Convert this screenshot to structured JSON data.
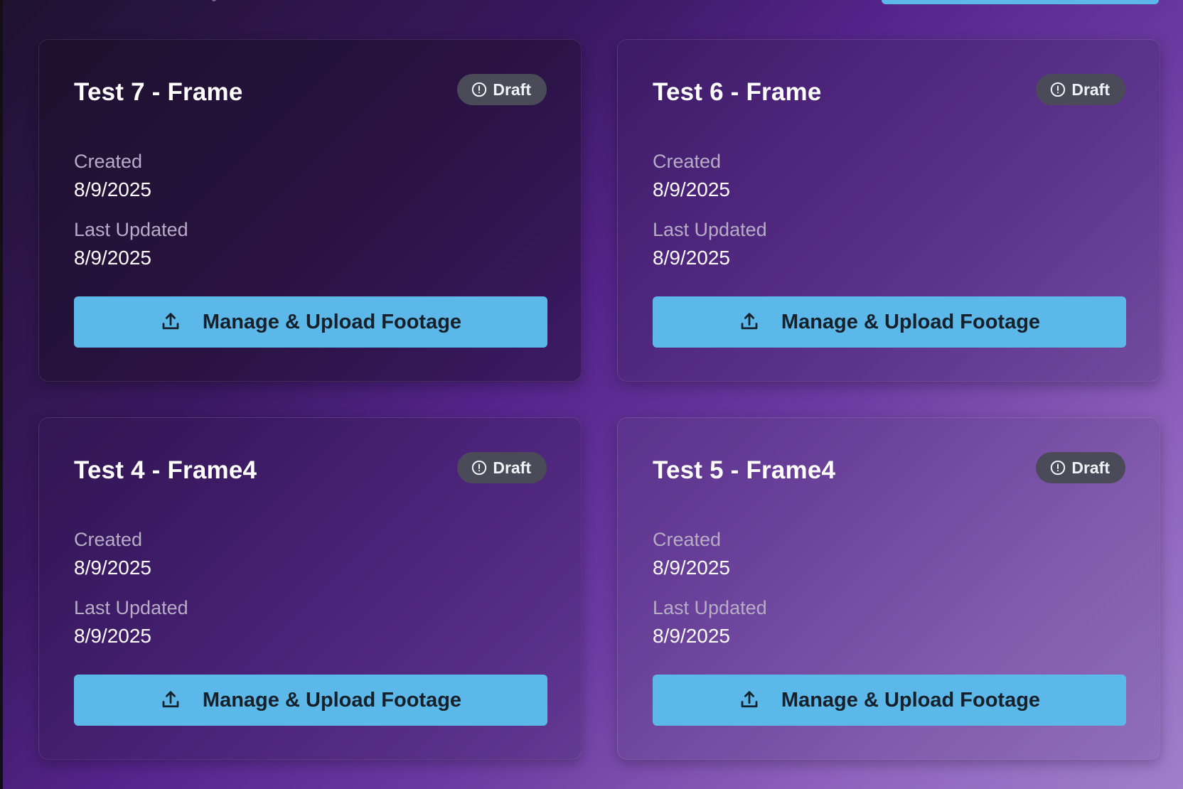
{
  "colors": {
    "accent": "#5bb8e8",
    "badge_bg": "#4a4a58",
    "title_text": "#ffffff",
    "label_text": "#b6adc6"
  },
  "cards": [
    {
      "title": "Test 7 - Frame",
      "status": "Draft",
      "status_icon": "alert-circle-icon",
      "created_label": "Created",
      "created": "8/9/2025",
      "updated_label": "Last Updated",
      "updated": "8/9/2025",
      "action_label": "Manage & Upload Footage",
      "action_icon": "upload-icon"
    },
    {
      "title": "Test 6 - Frame",
      "status": "Draft",
      "status_icon": "alert-circle-icon",
      "created_label": "Created",
      "created": "8/9/2025",
      "updated_label": "Last Updated",
      "updated": "8/9/2025",
      "action_label": "Manage & Upload Footage",
      "action_icon": "upload-icon"
    },
    {
      "title": "Test 4 - Frame4",
      "status": "Draft",
      "status_icon": "alert-circle-icon",
      "created_label": "Created",
      "created": "8/9/2025",
      "updated_label": "Last Updated",
      "updated": "8/9/2025",
      "action_label": "Manage & Upload Footage",
      "action_icon": "upload-icon"
    },
    {
      "title": "Test 5 - Frame4",
      "status": "Draft",
      "status_icon": "alert-circle-icon",
      "created_label": "Created",
      "created": "8/9/2025",
      "updated_label": "Last Updated",
      "updated": "8/9/2025",
      "action_label": "Manage & Upload Footage",
      "action_icon": "upload-icon"
    }
  ]
}
